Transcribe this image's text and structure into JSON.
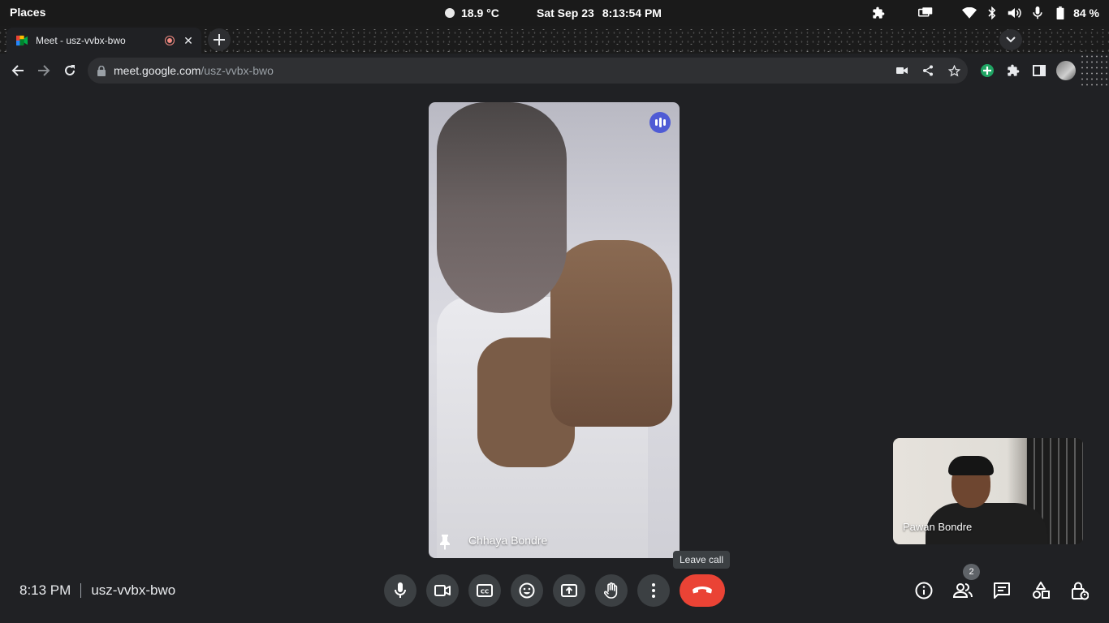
{
  "system_bar": {
    "places_label": "Places",
    "weather": "18.9 °C",
    "date": "Sat Sep 23",
    "time": "8:13:54 PM",
    "battery": "84 %",
    "tray_icons": [
      "extension-icon",
      "screen-share-icon",
      "wifi-icon",
      "bluetooth-icon",
      "volume-icon",
      "microphone-icon",
      "battery-icon"
    ]
  },
  "browser": {
    "tab": {
      "title": "Meet - usz-vvbx-bwo",
      "recording": true
    },
    "url_host": "meet.google.com",
    "url_path": "/usz-vvbx-bwo"
  },
  "meet": {
    "main_participant": "Chhaya Bondre",
    "self_participant": "Pawan Bondre",
    "tooltip": "Leave call",
    "clock": "8:13 PM",
    "meeting_code": "usz-vvbx-bwo",
    "participant_count": "2",
    "controls": [
      "microphone",
      "camera",
      "captions",
      "emoji",
      "present",
      "raise-hand",
      "more-options",
      "leave-call"
    ],
    "right_controls": [
      "meeting-info",
      "people",
      "chat",
      "activities",
      "host-controls"
    ],
    "colors": {
      "leave": "#ea4335",
      "speaking": "#4f5bd5",
      "control_bg": "#3c4043"
    }
  }
}
